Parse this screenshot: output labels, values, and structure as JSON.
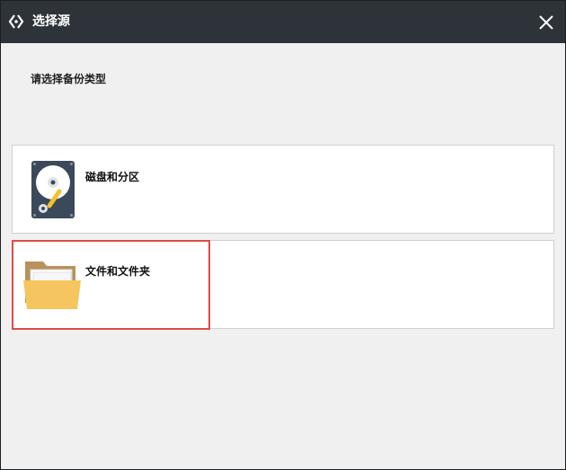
{
  "window": {
    "title": "选择源"
  },
  "prompt": "请选择备份类型",
  "options": [
    {
      "label": "磁盘和分区",
      "icon": "hard-disk-icon"
    },
    {
      "label": "文件和文件夹",
      "icon": "folder-icon",
      "selected": true
    }
  ],
  "colors": {
    "titlebar": "#2d3338",
    "background": "#f0f0f0",
    "selection": "#e14a4a",
    "folder": "#f5c560"
  }
}
